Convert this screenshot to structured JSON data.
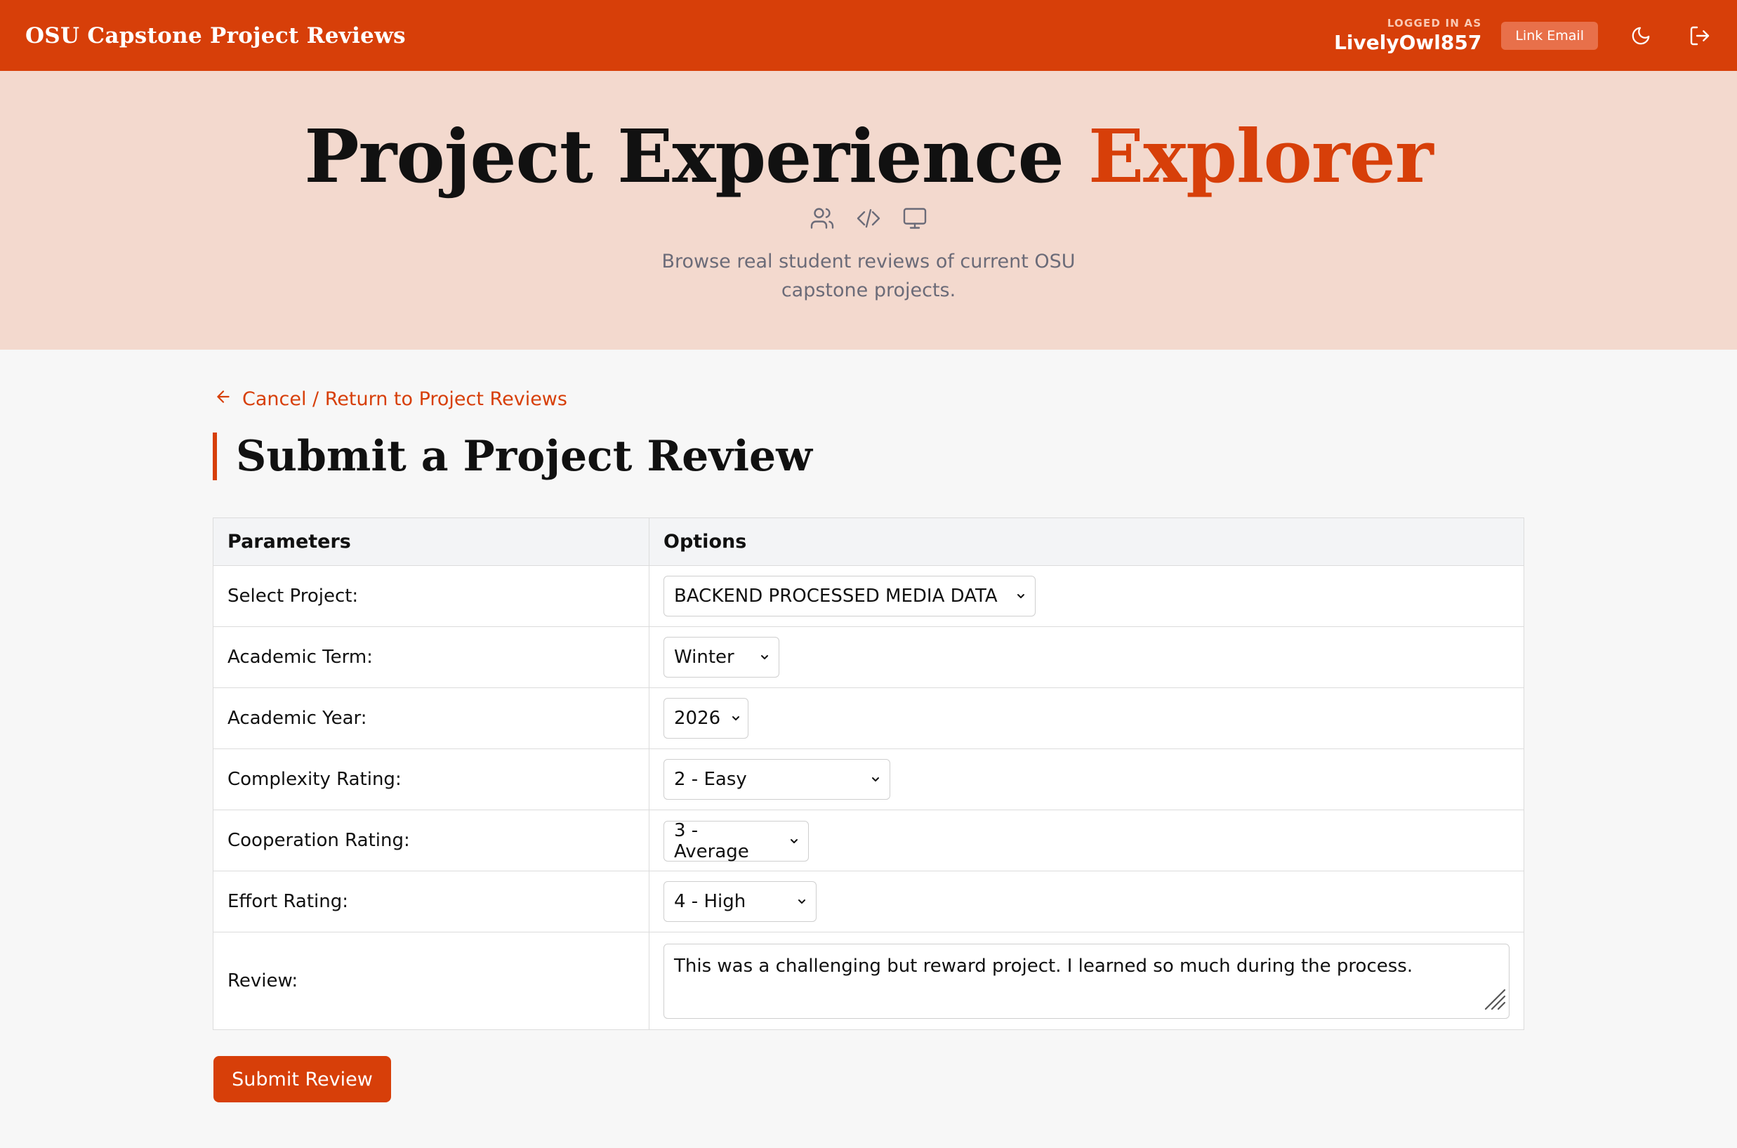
{
  "nav": {
    "brand": "OSU Capstone Project Reviews",
    "logged_in_label": "Logged in as",
    "username": "LivelyOwl857",
    "link_email_label": "Link Email",
    "icons": [
      "moon-icon",
      "logout-icon"
    ]
  },
  "hero": {
    "title_main": "Project Experience",
    "title_accent": "Explorer",
    "icons": [
      "users-icon",
      "code-icon",
      "monitor-icon"
    ],
    "subtitle": "Browse real student reviews of current OSU capstone projects."
  },
  "main": {
    "back_link": "Cancel / Return to Project Reviews",
    "heading": "Submit a Project Review",
    "table": {
      "headers": [
        "Parameters",
        "Options"
      ],
      "rows": [
        {
          "label": "Select Project:",
          "value": "BACKEND PROCESSED MEDIA DATA"
        },
        {
          "label": "Academic Term:",
          "value": "Winter"
        },
        {
          "label": "Academic Year:",
          "value": "2026"
        },
        {
          "label": "Complexity Rating:",
          "value": "2 - Easy"
        },
        {
          "label": "Cooperation Rating:",
          "value": "3 - Average"
        },
        {
          "label": "Effort Rating:",
          "value": "4 - High"
        }
      ],
      "review_label": "Review:",
      "review_text": "This was a challenging but reward project. I learned so much during the process."
    },
    "submit_label": "Submit Review"
  },
  "colors": {
    "brand": "#d73f09",
    "hero_bg": "#f3d9ce",
    "page_bg": "#f7f7f7"
  }
}
